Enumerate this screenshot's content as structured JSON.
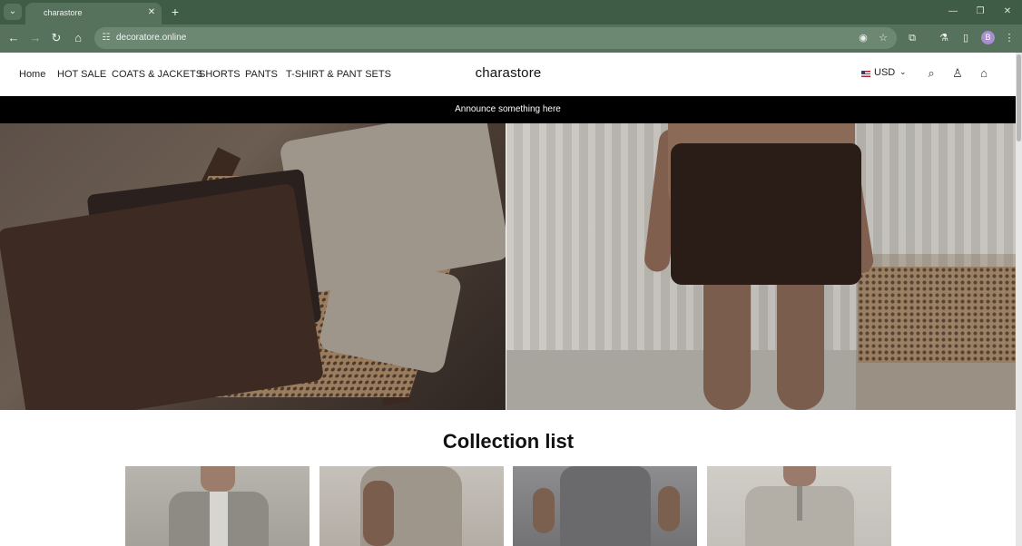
{
  "browser": {
    "tab": {
      "title": "charastore"
    },
    "address_bar": {
      "url": "decoratore.online"
    },
    "icons": {
      "tab_menu": "chevron-down-icon",
      "new_tab": "plus-icon",
      "back": "arrow-left-icon",
      "forward": "arrow-right-icon",
      "reload": "reload-icon",
      "home": "home-icon",
      "site_info": "tune-icon",
      "eye_off": "eye-off-icon",
      "star": "star-icon",
      "extensions": "puzzle-icon",
      "labs": "flask-icon",
      "side_panel": "side-panel-icon",
      "menu": "more-vertical-icon",
      "minimize": "minimize-icon",
      "restore": "restore-icon",
      "close": "close-icon"
    }
  },
  "store": {
    "nav": [
      "Home",
      "HOT SALE",
      "COATS & JACKETS",
      "SHORTS",
      "PANTS",
      "T-SHIRT & PANT SETS"
    ],
    "brand": "charastore",
    "currency": "USD",
    "icons": {
      "flag": "us-flag-icon",
      "currency_chevron": "chevron-down-icon",
      "search": "search-icon",
      "account": "account-icon",
      "cart": "shopping-bag-icon"
    },
    "announcement": "Announce something here",
    "collection_title": "Collection list"
  },
  "colors": {
    "browser_frame": "#3f5c47",
    "browser_toolbar": "#56725c",
    "announcement_bg": "#000000",
    "text": "#222222"
  }
}
